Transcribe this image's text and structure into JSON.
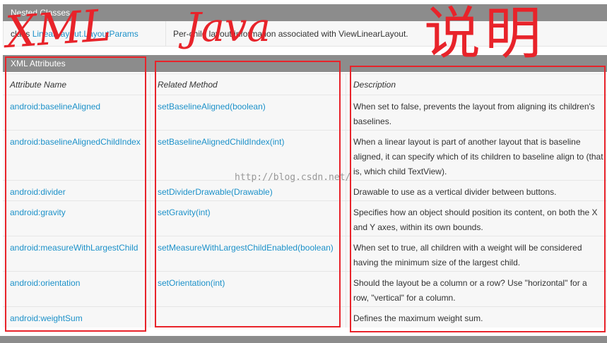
{
  "nested_classes": {
    "title": "Nested Classes",
    "rows": [
      {
        "keyword": "class",
        "name": "LinearLayout.LayoutParams",
        "description": "Per-child layout information associated with ViewLinearLayout."
      }
    ]
  },
  "xml_attributes": {
    "title": "XML Attributes",
    "columns": [
      "Attribute Name",
      "Related Method",
      "Description"
    ],
    "rows": [
      {
        "attribute": "android:baselineAligned",
        "method": "setBaselineAligned(boolean)",
        "description": "When set to false, prevents the layout from aligning its children's baselines."
      },
      {
        "attribute": "android:baselineAlignedChildIndex",
        "method": "setBaselineAlignedChildIndex(int)",
        "description": "When a linear layout is part of another layout that is baseline aligned, it can specify which of its children to baseline align to (that is, which child TextView)."
      },
      {
        "attribute": "android:divider",
        "method": "setDividerDrawable(Drawable)",
        "description": "Drawable to use as a vertical divider between buttons."
      },
      {
        "attribute": "android:gravity",
        "method": "setGravity(int)",
        "description": "Specifies how an object should position its content, on both the X and Y axes, within its own bounds."
      },
      {
        "attribute": "android:measureWithLargestChild",
        "method": "setMeasureWithLargestChildEnabled(boolean)",
        "description": "When set to true, all children with a weight will be considered having the minimum size of the largest child."
      },
      {
        "attribute": "android:orientation",
        "method": "setOrientation(int)",
        "description": "Should the layout be a column or a row? Use \"horizontal\" for a row, \"vertical\" for a column."
      },
      {
        "attribute": "android:weightSum",
        "method": "",
        "description": "Defines the maximum weight sum."
      }
    ]
  },
  "annotations": {
    "xml": "XML",
    "java": "Java",
    "description": "说明"
  },
  "watermark": "http://blog.csdn.net/",
  "colors": {
    "link": "#1c91c9",
    "header_bg": "#8c8c8c",
    "annotation": "#e8232a"
  }
}
